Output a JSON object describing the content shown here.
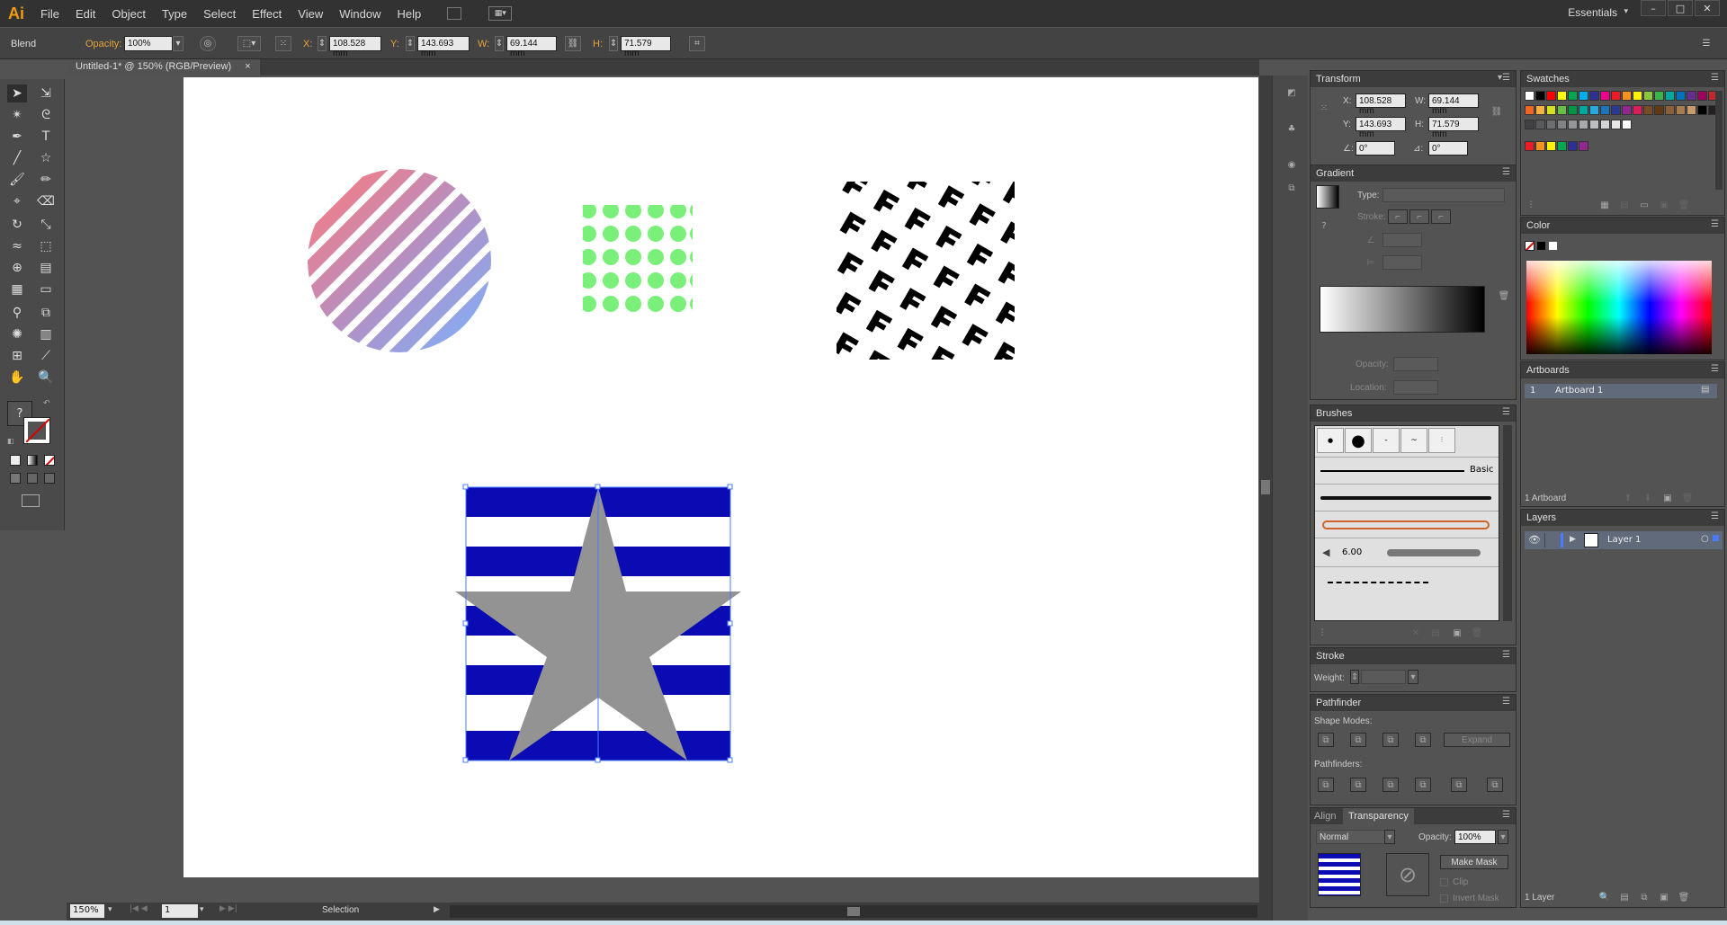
{
  "app": {
    "logo": "Ai",
    "workspace": "Essentials"
  },
  "menu": [
    "File",
    "Edit",
    "Object",
    "Type",
    "Select",
    "Effect",
    "View",
    "Window",
    "Help"
  ],
  "window_buttons": [
    "–",
    "□",
    "✕"
  ],
  "control": {
    "selection_type": "Blend",
    "opacity_label": "Opacity:",
    "opacity_value": "100%",
    "x_label": "X:",
    "x_value": "108.528 mm",
    "y_label": "Y:",
    "y_value": "143.693 mm",
    "w_label": "W:",
    "w_value": "69.144 mm",
    "h_label": "H:",
    "h_value": "71.579 mm"
  },
  "document": {
    "tab_title": "Untitled-1* @ 150% (RGB/Preview)",
    "close": "×"
  },
  "status": {
    "zoom": "150%",
    "artboard_nav": "1",
    "tool_name": "Selection"
  },
  "panels": {
    "transform": {
      "title": "Transform",
      "x_label": "X:",
      "x_value": "108.528 mm",
      "y_label": "Y:",
      "y_value": "143.693 mm",
      "w_label": "W:",
      "w_value": "69.144 mm",
      "h_label": "H:",
      "h_value": "71.579 mm",
      "angle_value": "0°",
      "shear_value": "0°"
    },
    "gradient": {
      "title": "Gradient",
      "type_label": "Type:",
      "stroke_label": "Stroke:",
      "opacity_label": "Opacity:",
      "location_label": "Location:"
    },
    "brushes": {
      "title": "Brushes",
      "basic_label": "Basic",
      "size_value": "6.00"
    },
    "stroke": {
      "title": "Stroke",
      "weight_label": "Weight:"
    },
    "pathfinder": {
      "title": "Pathfinder",
      "shape_modes_label": "Shape Modes:",
      "pathfinders_label": "Pathfinders:",
      "expand_label": "Expand"
    },
    "transparency": {
      "align_tab": "Align",
      "title": "Transparency",
      "blend_mode": "Normal",
      "opacity_label": "Opacity:",
      "opacity_value": "100%",
      "make_mask_label": "Make Mask",
      "clip_label": "Clip",
      "invert_mask_label": "Invert Mask"
    },
    "swatches": {
      "title": "Swatches"
    },
    "color": {
      "title": "Color"
    },
    "artboards": {
      "title": "Artboards",
      "row_index": "1",
      "row_name": "Artboard 1",
      "footer": "1 Artboard"
    },
    "layers": {
      "title": "Layers",
      "layer_name": "Layer 1",
      "footer": "1 Layer"
    }
  },
  "swatch_colors": {
    "row1": [
      "#ffffff",
      "#000000",
      "#ff0000",
      "#ffff00",
      "#00a651",
      "#00aeef",
      "#2e3192",
      "#ec008c",
      "#ed1c24",
      "#f7941d",
      "#fff200",
      "#8dc63f",
      "#39b54a",
      "#00a99d",
      "#0072bc",
      "#662d91",
      "#9e005d",
      "#c1272d"
    ],
    "row2": [
      "#f26522",
      "#fbb040",
      "#d7df23",
      "#6abd45",
      "#009444",
      "#00a79d",
      "#27aae1",
      "#1c75bc",
      "#2b3990",
      "#92278f",
      "#d91c5c",
      "#754c24",
      "#603913",
      "#8b5e3c",
      "#a97c50",
      "#c69c6d",
      "#000000",
      "#231f20"
    ],
    "row3": [
      "#414042",
      "#58595b",
      "#6d6e71",
      "#808285",
      "#939598",
      "#a7a9ac",
      "#bcbec0",
      "#d1d3d4",
      "#e6e7e8",
      "#ffffff"
    ],
    "row4": [
      "#ed1c24",
      "#f7941d",
      "#fff200",
      "#00a651",
      "#2e3192",
      "#92278f"
    ]
  }
}
